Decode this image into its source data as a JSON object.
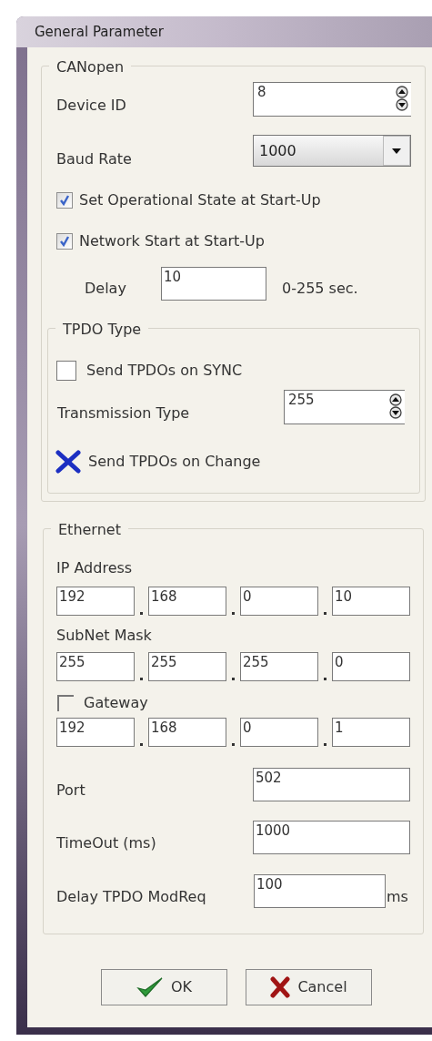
{
  "window": {
    "title": "General Parameter"
  },
  "canopen": {
    "legend": "CANopen",
    "device_id": {
      "label": "Device ID",
      "value": "8"
    },
    "baud_rate": {
      "label": "Baud Rate",
      "value": "1000"
    },
    "options": [
      {
        "label": "Set Operational State at Start-Up",
        "checked": true
      },
      {
        "label": "Network Start at Start-Up",
        "checked": true
      }
    ],
    "delay": {
      "label": "Delay",
      "value": "10",
      "unit": "0-255 sec."
    }
  },
  "tpdo_type": {
    "legend": "TPDO Type",
    "sync": {
      "label": "Send TPDOs on SYNC",
      "checked": false
    },
    "transmission_type": {
      "label": "Transmission Type",
      "value": "255"
    },
    "on_change": {
      "label": "Send TPDOs on Change",
      "checked": true
    }
  },
  "ethernet": {
    "legend": "Ethernet",
    "ip_address": {
      "label": "IP Address",
      "octets": [
        "192",
        "168",
        "0",
        "10"
      ]
    },
    "subnet_mask": {
      "label": "SubNet Mask",
      "octets": [
        "255",
        "255",
        "255",
        "0"
      ]
    },
    "gateway": {
      "label": "Gateway",
      "checked": false,
      "octets": [
        "192",
        "168",
        "0",
        "1"
      ]
    },
    "port": {
      "label": "Port",
      "value": "502"
    },
    "timeout": {
      "label": "TimeOut (ms)",
      "value": "1000"
    },
    "delay_tpdo": {
      "label": "Delay TPDO ModReq",
      "value": "100",
      "unit": "ms"
    }
  },
  "buttons": [
    {
      "label": "OK",
      "kind": "ok"
    },
    {
      "label": "Cancel",
      "kind": "cancel"
    }
  ]
}
